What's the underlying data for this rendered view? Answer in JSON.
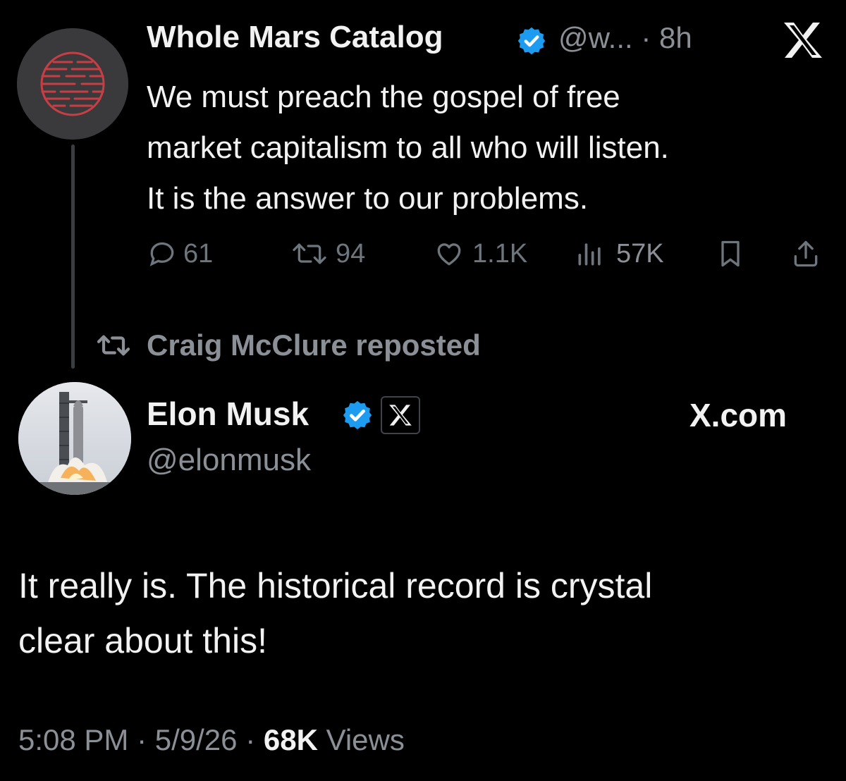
{
  "quoted_tweet": {
    "author_name": "Whole Mars Catalog",
    "handle": "@w...",
    "separator": " · ",
    "time": "8h",
    "text_lines": [
      "We must preach the gospel of free",
      "market capitalism to all who will listen.",
      "It is the answer to our problems."
    ],
    "stats": {
      "replies": "61",
      "reposts": "94",
      "likes": "1.1K",
      "views": "57K"
    }
  },
  "repost_label": "Craig McClure reposted",
  "main_tweet": {
    "author_name": "Elon Musk",
    "handle": "@elonmusk",
    "affiliate_link": "X.com",
    "text_lines": [
      "It really is. The historical record is crystal",
      "clear about this!"
    ],
    "time": "5:08 PM",
    "date": "5/9/26",
    "separator": " · ",
    "views_count": "68K",
    "views_label": " Views"
  },
  "colors": {
    "background": "#000000",
    "text": "#f2f2f2",
    "muted": "#8b9096",
    "verified_blue": "#1d9bf0",
    "action_gray": "#6e767d",
    "avatar_red": "#c73f45"
  },
  "icons": [
    "whole-mars-logo",
    "verified-badge-icon",
    "x-logo-icon",
    "reply-icon",
    "repost-icon",
    "like-icon",
    "views-icon",
    "bookmark-icon",
    "share-icon",
    "rocket-avatar"
  ]
}
